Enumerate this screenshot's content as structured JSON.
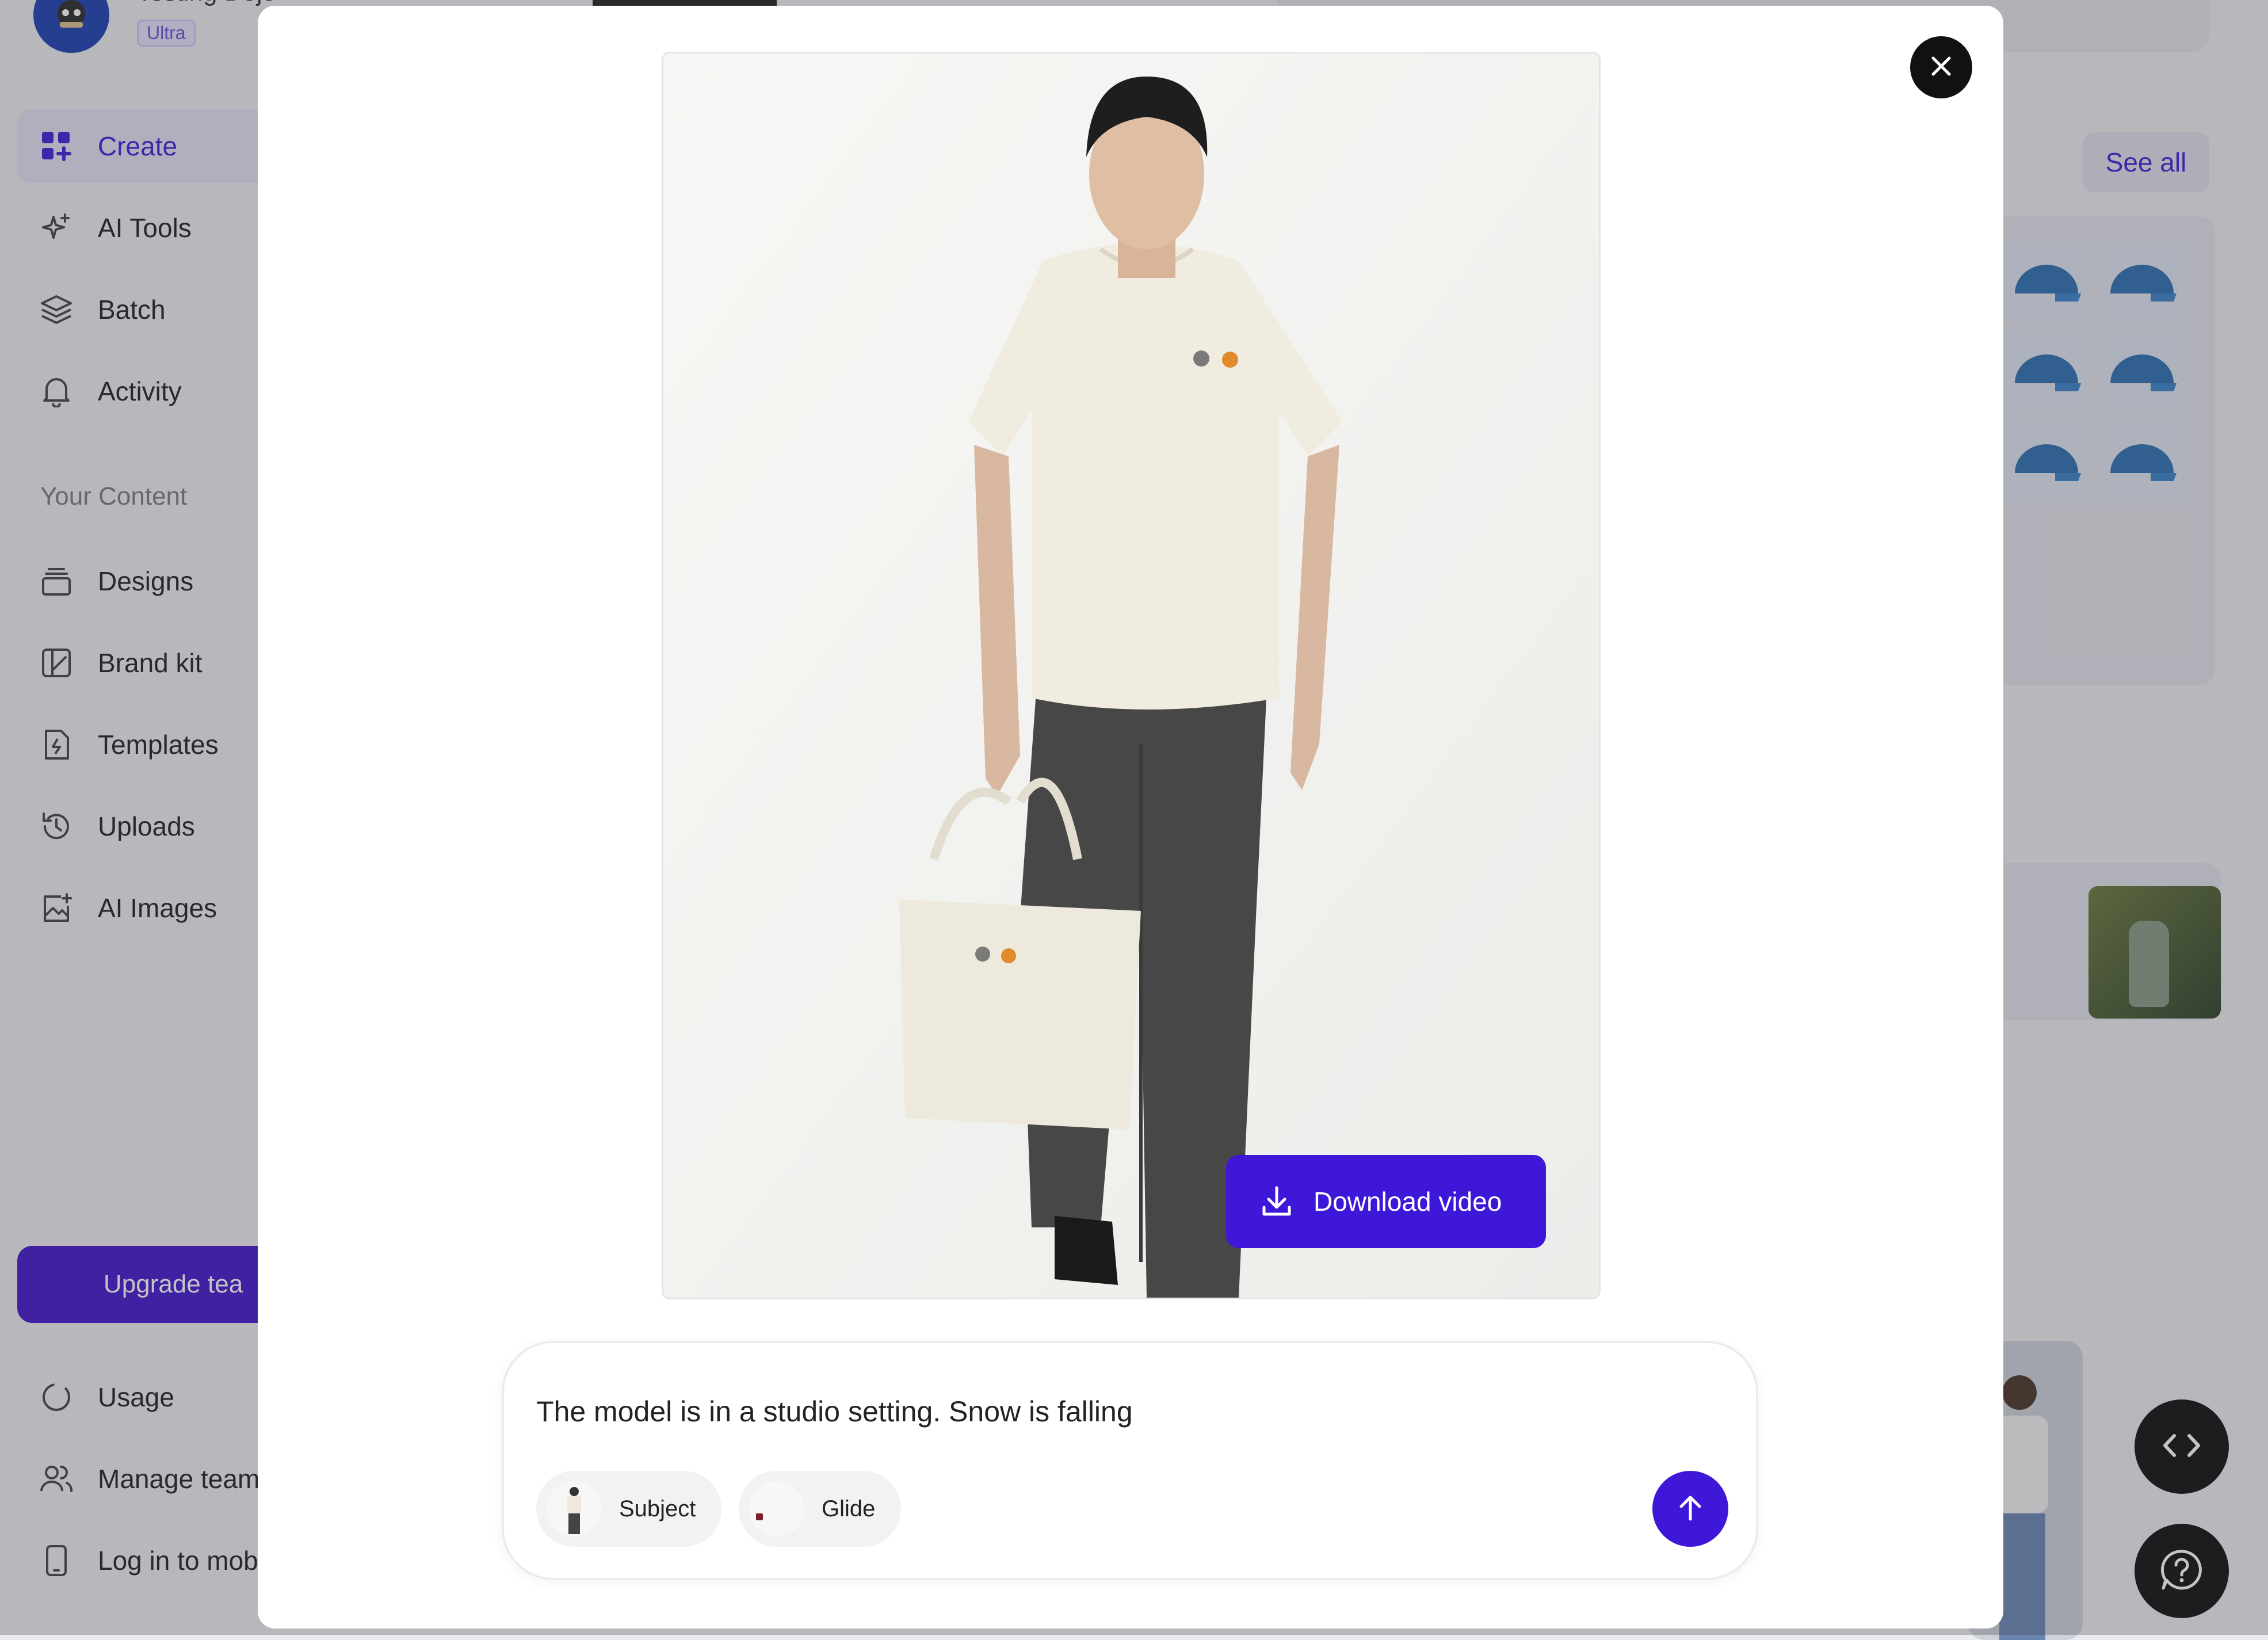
{
  "account": {
    "name": "Testing Dojo",
    "plan": "Ultra"
  },
  "sidebar": {
    "nav": [
      {
        "label": "Create",
        "icon": "grid-plus-icon",
        "active": true
      },
      {
        "label": "AI Tools",
        "icon": "sparkle-icon"
      },
      {
        "label": "Batch",
        "icon": "layers-icon"
      },
      {
        "label": "Activity",
        "icon": "bell-icon"
      }
    ],
    "section_label": "Your Content",
    "content": [
      {
        "label": "Designs",
        "icon": "stack-icon"
      },
      {
        "label": "Brand kit",
        "icon": "brand-icon"
      },
      {
        "label": "Templates",
        "icon": "template-icon"
      },
      {
        "label": "Uploads",
        "icon": "history-icon"
      },
      {
        "label": "AI Images",
        "icon": "image-plus-icon"
      }
    ],
    "upgrade_label": "Upgrade tea",
    "footer": [
      {
        "label": "Usage",
        "icon": "usage-icon"
      },
      {
        "label": "Manage team",
        "icon": "users-icon"
      },
      {
        "label": "Log in to mob",
        "icon": "phone-icon"
      }
    ]
  },
  "main": {
    "see_all": "See all"
  },
  "modal": {
    "download_label": "Download video",
    "prompt_text": "The model is in a studio setting. Snow is falling",
    "chips": [
      {
        "label": "Subject"
      },
      {
        "label": "Glide"
      }
    ]
  },
  "colors": {
    "accent": "#3f17d9",
    "active_nav": "#3b1fd6",
    "dark": "#111111"
  }
}
